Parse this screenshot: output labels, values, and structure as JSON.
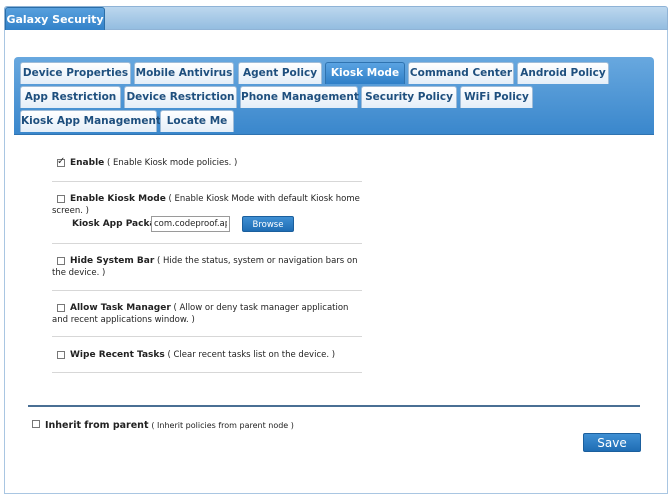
{
  "app": {
    "title": "Galaxy Security"
  },
  "tabs": [
    {
      "label": "Device Properties"
    },
    {
      "label": "Mobile Antivirus"
    },
    {
      "label": "Agent Policy"
    },
    {
      "label": "Kiosk Mode"
    },
    {
      "label": "Command Center"
    },
    {
      "label": "Android Policy"
    },
    {
      "label": "App Restriction"
    },
    {
      "label": "Device Restriction"
    },
    {
      "label": "Phone Management"
    },
    {
      "label": "Security Policy"
    },
    {
      "label": "WiFi Policy"
    },
    {
      "label": "Kiosk App Management"
    },
    {
      "label": "Locate Me"
    }
  ],
  "active_tab": "Kiosk Mode",
  "settings": {
    "enable": {
      "label": "Enable",
      "desc": "( Enable Kiosk mode policies. )",
      "checked": true
    },
    "kiosk_mode": {
      "label": "Enable Kiosk Mode",
      "desc": "( Enable Kiosk Mode with default Kiosk home screen. )",
      "checked": false
    },
    "package": {
      "label": "Kiosk App Package",
      "value": "com.codeproof.appr",
      "browse": "Browse"
    },
    "hide_bar": {
      "label": "Hide System Bar",
      "desc": "( Hide the status, system or navigation bars on the device. )",
      "checked": false
    },
    "task_manager": {
      "label": "Allow Task Manager",
      "desc": "( Allow or deny task manager application and recent applications window. )",
      "checked": false
    },
    "wipe_tasks": {
      "label": "Wipe Recent Tasks",
      "desc": "( Clear recent tasks list on the device. )",
      "checked": false
    }
  },
  "inherit": {
    "label": "Inherit from parent",
    "desc": "( Inherit policies from parent node )",
    "checked": false
  },
  "save_label": "Save"
}
